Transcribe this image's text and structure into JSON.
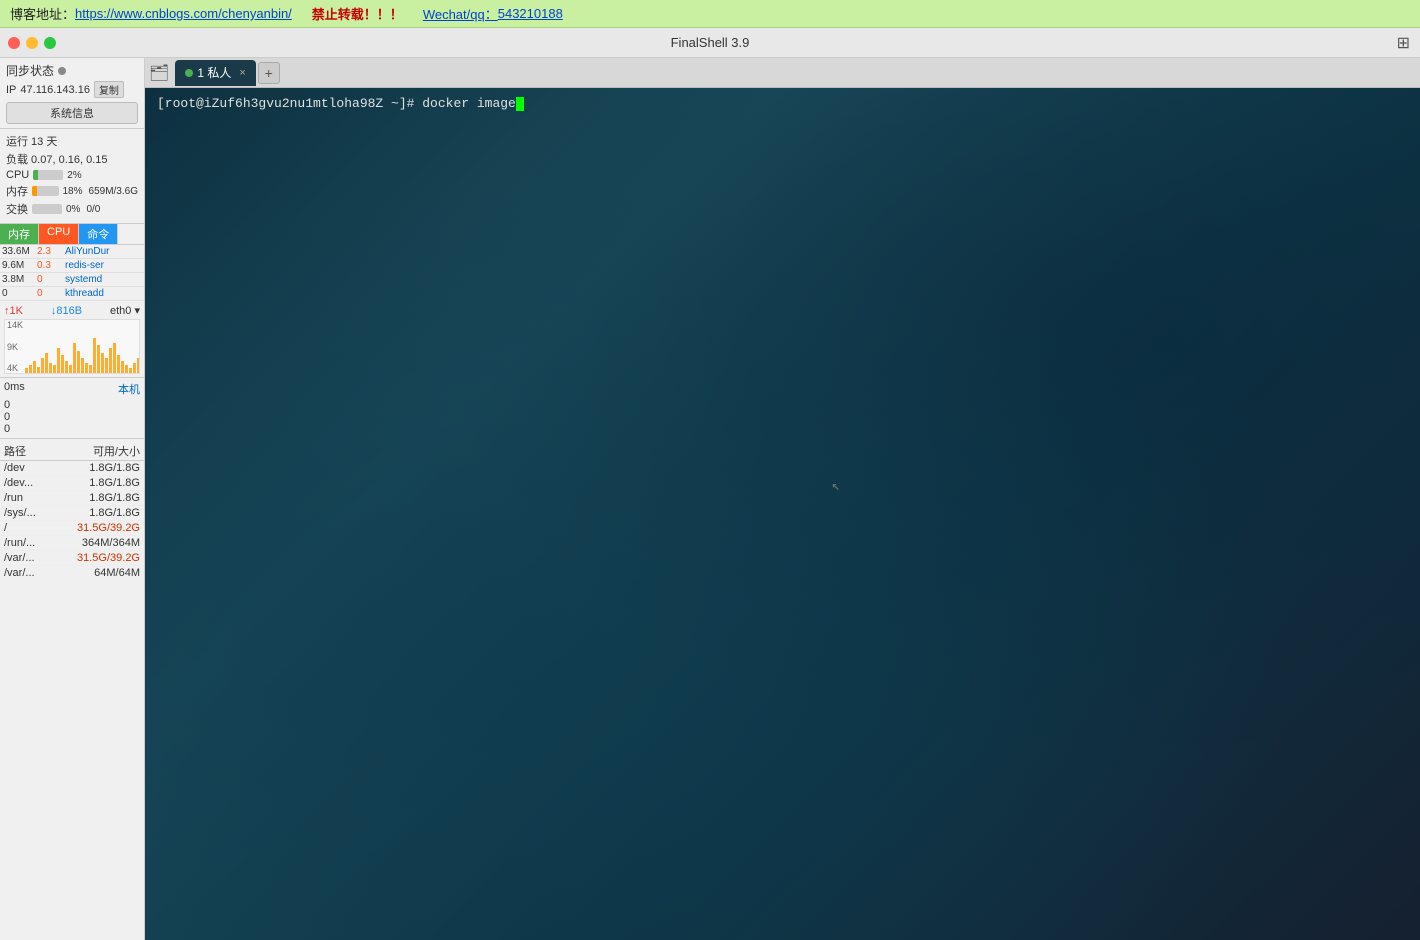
{
  "banner": {
    "blog_label": "博客地址：",
    "blog_url": "https://www.cnblogs.com/chenyanbin/",
    "no_copy": "禁止转载！！！",
    "wechat_label": "Wechat/qq：",
    "wechat_num": "543210188"
  },
  "titlebar": {
    "app_name": "FinalShell 3.9"
  },
  "sidebar": {
    "sync_label": "同步状态",
    "ip_label": "IP",
    "ip_value": "47.116.143.16",
    "copy_label": "复制",
    "sysinfo_label": "系统信息",
    "uptime_label": "运行 13 天",
    "load_label": "负载 0.07, 0.16, 0.15",
    "cpu_label": "CPU",
    "cpu_percent": "2%",
    "cpu_bar_width": 15,
    "mem_label": "内存",
    "mem_percent": "18%",
    "mem_value": "659M/3.6G",
    "mem_bar_width": 18,
    "swap_label": "交换",
    "swap_percent": "0%",
    "swap_value": "0/0",
    "swap_bar_width": 0,
    "proc_tab_mem": "内存",
    "proc_tab_cpu": "CPU",
    "proc_tab_cmd": "命令",
    "processes": [
      {
        "mem": "33.6M",
        "cpu": "2.3",
        "name": "AliYunDur"
      },
      {
        "mem": "9.6M",
        "cpu": "0.3",
        "name": "redis-ser"
      },
      {
        "mem": "3.8M",
        "cpu": "0",
        "name": "systemd"
      },
      {
        "mem": "0",
        "cpu": "0",
        "name": "kthreadd"
      }
    ],
    "net_up": "↑1K",
    "net_down": "↓816B",
    "net_interface": "eth0",
    "net_levels": [
      "14K",
      "9K",
      "4K"
    ],
    "ping_label": "0ms",
    "ping_local": "本机",
    "ping_values": [
      "0",
      "0",
      "0"
    ],
    "disk_path_col": "路径",
    "disk_size_col": "可用/大小",
    "disks": [
      {
        "path": "/dev",
        "size": "1.8G/1.8G"
      },
      {
        "path": "/dev...",
        "size": "1.8G/1.8G"
      },
      {
        "path": "/run",
        "size": "1.8G/1.8G"
      },
      {
        "path": "/sys/...",
        "size": "1.8G/1.8G"
      },
      {
        "path": "/",
        "size": "31.5G/39.2G",
        "highlight": true
      },
      {
        "path": "/run/...",
        "size": "364M/364M"
      },
      {
        "path": "/var/...",
        "size": "31.5G/39.2G",
        "highlight": true
      },
      {
        "path": "/var/...",
        "size": "64M/64M"
      }
    ]
  },
  "tabs": [
    {
      "label": "1 私人",
      "active": true
    }
  ],
  "tab_new": "+",
  "terminal": {
    "prompt": "[root@iZuf6h3gvu2nu1mtloha98Z ~]# docker image"
  },
  "icons": {
    "folder": "🗂",
    "grid": "⊞",
    "close": "×",
    "arrow_up": "↑",
    "arrow_down": "↓",
    "chevron_down": "▾"
  }
}
